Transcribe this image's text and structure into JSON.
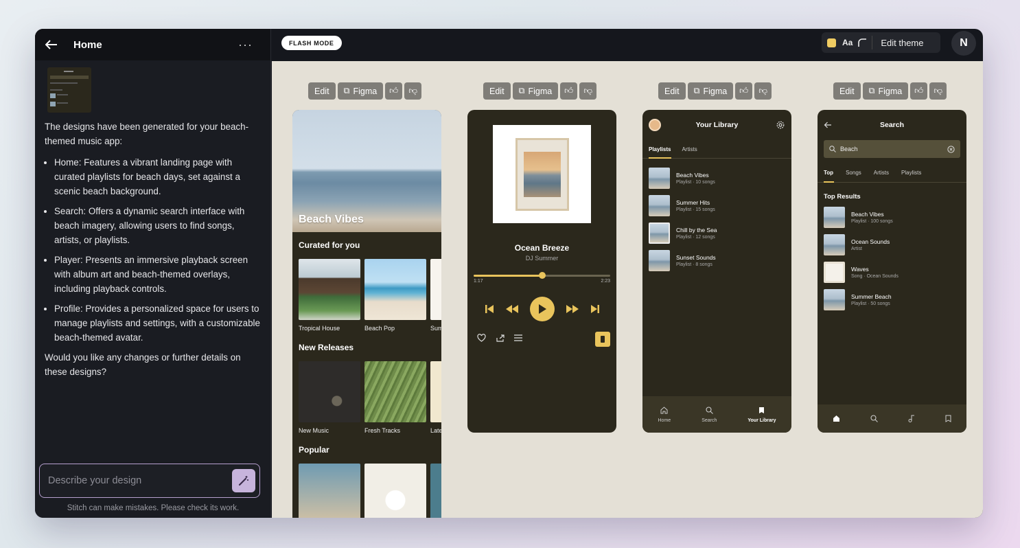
{
  "left_panel": {
    "title": "Home",
    "more": "···",
    "messages": {
      "intro": "The designs have been generated for your beach-themed music app:",
      "bullets": [
        "Home: Features a vibrant landing page with curated playlists for beach days, set against a scenic beach background.",
        "Search: Offers a dynamic search interface with beach imagery, allowing users to find songs, artists, or playlists.",
        "Player: Presents an immersive playback screen with album art and beach-themed overlays, including playback controls.",
        "Profile: Provides a personalized space for users to manage playlists and settings, with a customizable beach-themed avatar."
      ],
      "followup": "Would you like any changes or further details on these designs?"
    },
    "compose_placeholder": "Describe your design",
    "disclaimer": "Stitch can make mistakes. Please check its work."
  },
  "topbar": {
    "flash_mode": "FLASH MODE",
    "theme_aa": "Aa",
    "edit_theme": "Edit theme",
    "avatar_initial": "N",
    "swatch_color": "#f0cc62"
  },
  "toolbar": {
    "edit": "Edit",
    "figma": "Figma"
  },
  "home_screen": {
    "hero_title": "Beach Vibes",
    "curated_title": "Curated for you",
    "curated": [
      "Tropical House",
      "Beach Pop",
      "Sum"
    ],
    "new_title": "New Releases",
    "new": [
      "New Music",
      "Fresh Tracks",
      "Late"
    ],
    "popular_title": "Popular"
  },
  "player_screen": {
    "song": "Ocean Breeze",
    "artist": "DJ Summer",
    "elapsed": "1:17",
    "duration": "2:23",
    "progress": 0.5
  },
  "library_screen": {
    "title": "Your Library",
    "tabs": [
      "Playlists",
      "Artists"
    ],
    "items": [
      {
        "name": "Beach Vibes",
        "sub": "Playlist · 10 songs"
      },
      {
        "name": "Summer Hits",
        "sub": "Playlist · 15 songs"
      },
      {
        "name": "Chill by the Sea",
        "sub": "Playlist · 12 songs"
      },
      {
        "name": "Sunset Sounds",
        "sub": "Playlist · 8 songs"
      }
    ],
    "nav": [
      "Home",
      "Search",
      "Your Library"
    ]
  },
  "search_screen": {
    "title": "Search",
    "query": "Beach",
    "tabs": [
      "Top",
      "Songs",
      "Artists",
      "Playlists"
    ],
    "results_title": "Top Results",
    "results": [
      {
        "name": "Beach Vibes",
        "sub": "Playlist · 100 songs"
      },
      {
        "name": "Ocean Sounds",
        "sub": "Artist"
      },
      {
        "name": "Waves",
        "sub": "Song · Ocean Sounds"
      },
      {
        "name": "Summer Beach",
        "sub": "Playlist · 50 songs"
      }
    ]
  }
}
